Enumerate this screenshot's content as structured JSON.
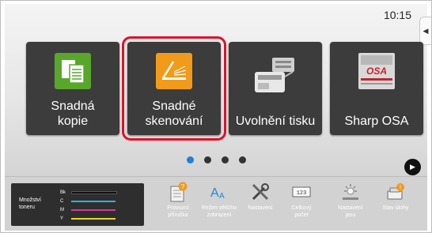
{
  "status": {
    "time": "10:15",
    "side_tab_glyph": "◀"
  },
  "tiles": [
    {
      "label": "Snadná kopie",
      "line1": "Snadná",
      "line2": "kopie",
      "icon": "copy-icon",
      "color": "#59a72a"
    },
    {
      "label": "Snadné skenování",
      "line1": "Snadné",
      "line2": "skenování",
      "icon": "scan-icon",
      "color": "#f29a1a",
      "highlighted": true
    },
    {
      "label": "Uvolnění tisku",
      "icon": "printer-icon"
    },
    {
      "label": "Sharp OSA",
      "icon": "osa-icon"
    }
  ],
  "pager": {
    "total": 4,
    "active_index": 0,
    "next_glyph": "▶"
  },
  "toner": {
    "title_line1": "Množství",
    "title_line2": "toneru",
    "rows": [
      {
        "key": "Bk",
        "color": "#101010"
      },
      {
        "key": "C",
        "color": "#2bb5d8"
      },
      {
        "key": "M",
        "color": "#d23c98"
      },
      {
        "key": "Y",
        "color": "#e6d430"
      }
    ]
  },
  "function_bar": [
    {
      "line1": "Provozní",
      "line2": "příručka",
      "icon": "manual-icon"
    },
    {
      "line1": "Režim většího",
      "line2": "zobrazení",
      "icon": "large-text-icon"
    },
    {
      "line1": "Nastavení",
      "line2": "",
      "icon": "tools-icon"
    },
    {
      "line1": "Celkový",
      "line2": "počet",
      "icon": "counter-icon"
    },
    {
      "line1": "Nastavení",
      "line2": "jasu",
      "icon": "brightness-icon"
    },
    {
      "line1": "Stav úlohy",
      "line2": "",
      "icon": "job-status-icon"
    }
  ]
}
